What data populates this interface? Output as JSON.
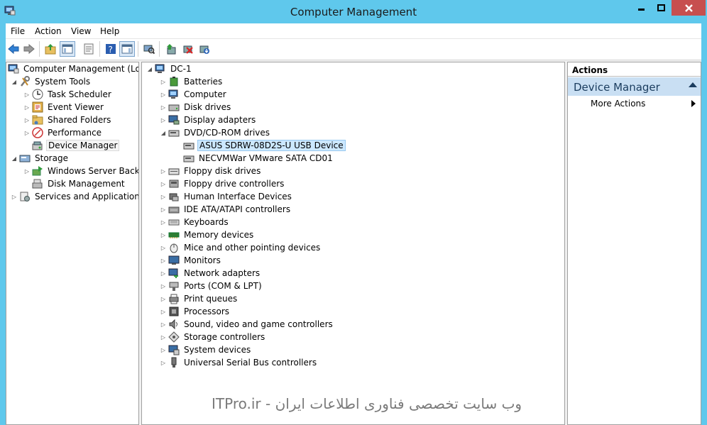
{
  "window": {
    "title": "Computer Management"
  },
  "menu": [
    "File",
    "Action",
    "View",
    "Help"
  ],
  "toolbar_icons": [
    "back-icon",
    "forward-icon",
    "up-folder-icon",
    "show-hide-tree-icon",
    "properties-icon",
    "help-icon",
    "show-hide-action-pane-icon",
    "scan-hardware-icon",
    "update-driver-icon",
    "disable-device-icon",
    "uninstall-device-icon"
  ],
  "tree": {
    "root": "Computer Management (Local",
    "system_tools": "System Tools",
    "task_scheduler": "Task Scheduler",
    "event_viewer": "Event Viewer",
    "shared_folders": "Shared Folders",
    "performance": "Performance",
    "device_manager": "Device Manager",
    "storage": "Storage",
    "windows_server_backup": "Windows Server Backup",
    "disk_management": "Disk Management",
    "services_apps": "Services and Applications"
  },
  "devices": {
    "root": "DC-1",
    "categories": [
      "Batteries",
      "Computer",
      "Disk drives",
      "Display adapters",
      "DVD/CD-ROM drives",
      "Floppy disk drives",
      "Floppy drive controllers",
      "Human Interface Devices",
      "IDE ATA/ATAPI controllers",
      "Keyboards",
      "Memory devices",
      "Mice and other pointing devices",
      "Monitors",
      "Network adapters",
      "Ports (COM & LPT)",
      "Print queues",
      "Processors",
      "Sound, video and game controllers",
      "Storage controllers",
      "System devices",
      "Universal Serial Bus controllers"
    ],
    "dvd_children": [
      "ASUS SDRW-08D2S-U USB Device",
      "NECVMWar VMware SATA CD01"
    ]
  },
  "actions": {
    "header": "Actions",
    "section": "Device Manager",
    "more": "More Actions"
  },
  "watermark": "وب سایت تخصصی فناوری اطلاعات ایران - ITPro.ir"
}
